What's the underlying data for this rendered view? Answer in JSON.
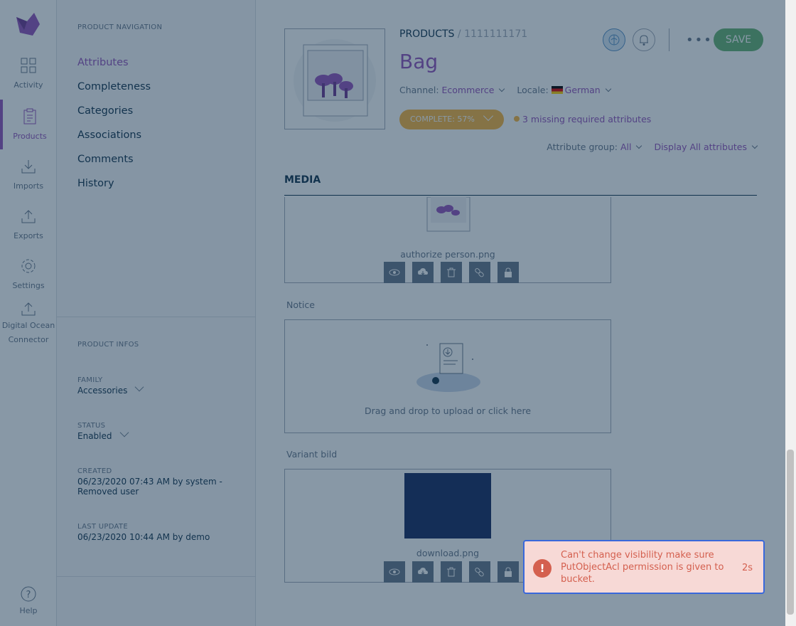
{
  "menu": {
    "items": [
      {
        "label": "Activity",
        "icon": "activity-icon"
      },
      {
        "label": "Products",
        "icon": "products-icon"
      },
      {
        "label": "Imports",
        "icon": "imports-icon"
      },
      {
        "label": "Exports",
        "icon": "exports-icon"
      },
      {
        "label": "Settings",
        "icon": "settings-icon"
      },
      {
        "label": "Digital Ocean Connector",
        "icon": "connector-icon"
      }
    ],
    "help_label": "Help"
  },
  "column": {
    "nav_title": "PRODUCT NAVIGATION",
    "nav": [
      "Attributes",
      "Completeness",
      "Categories",
      "Associations",
      "Comments",
      "History"
    ],
    "infos_title": "PRODUCT INFOS",
    "family_label": "FAMILY",
    "family_value": "Accessories",
    "status_label": "STATUS",
    "status_value": "Enabled",
    "created_label": "CREATED",
    "created_value": "06/23/2020 07:43 AM by system - Removed user",
    "updated_label": "LAST UPDATE",
    "updated_value": "06/23/2020 10:44 AM by demo"
  },
  "header": {
    "breadcrumb": "PRODUCTS",
    "separator": " / ",
    "sku": "1111111171",
    "title": "Bag",
    "channel_label": "Channel: ",
    "channel_value": "Ecommerce",
    "locale_label": "Locale: ",
    "locale_value": "German",
    "complete": "COMPLETE: 57%",
    "missing": "3 missing required attributes",
    "save": "SAVE",
    "more": "•••",
    "attr_group_label": "Attribute group: ",
    "attr_group_value": "All",
    "display_value": "Display All attributes"
  },
  "section": {
    "title": "MEDIA",
    "fields": [
      {
        "file": "authorize person.png"
      },
      {
        "label": "Notice",
        "dropzone": "Drag and drop to upload or click here"
      },
      {
        "label": "Variant bild",
        "file": "download.png"
      }
    ]
  },
  "toast": {
    "icon": "!",
    "message": "Can't change visibility make sure PutObjectAcl permission is given to bucket.",
    "countdown": "2s"
  },
  "colors": {
    "accent": "#9452ba",
    "save": "#67b373",
    "warning": "#f9b53f",
    "error": "#d4604f"
  }
}
